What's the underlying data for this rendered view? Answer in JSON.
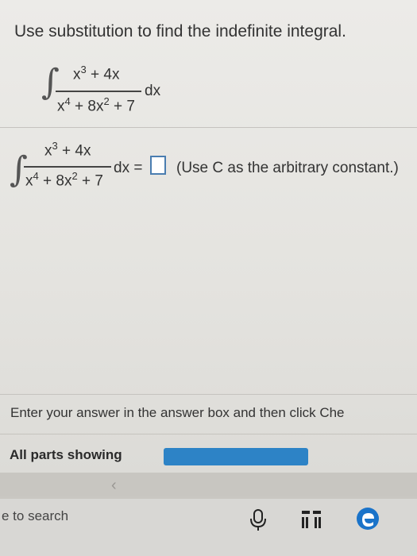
{
  "question": "Use substitution to find the indefinite integral.",
  "integral_top": {
    "num_base": "x",
    "num_exp": "3",
    "num_rest": " + 4x",
    "den_base": "x",
    "den_exp": "4",
    "den_mid": " + 8x",
    "den_exp2": "2",
    "den_rest": " + 7",
    "dx": "dx"
  },
  "integral_answer": {
    "num_base": "x",
    "num_exp": "3",
    "num_rest": " + 4x",
    "den_base": "x",
    "den_exp": "4",
    "den_mid": " + 8x",
    "den_exp2": "2",
    "den_rest": " + 7",
    "dx_eq": "dx =",
    "hint": "(Use C as the arbitrary constant.)"
  },
  "answer_value": "",
  "instruction": "Enter your answer in the answer box and then click Che",
  "status_label": "All parts showing",
  "progress_percent": 100,
  "taskbar": {
    "search": "e to search"
  },
  "colors": {
    "accent": "#2d83c6",
    "answer_box_border": "#4a7db0"
  }
}
